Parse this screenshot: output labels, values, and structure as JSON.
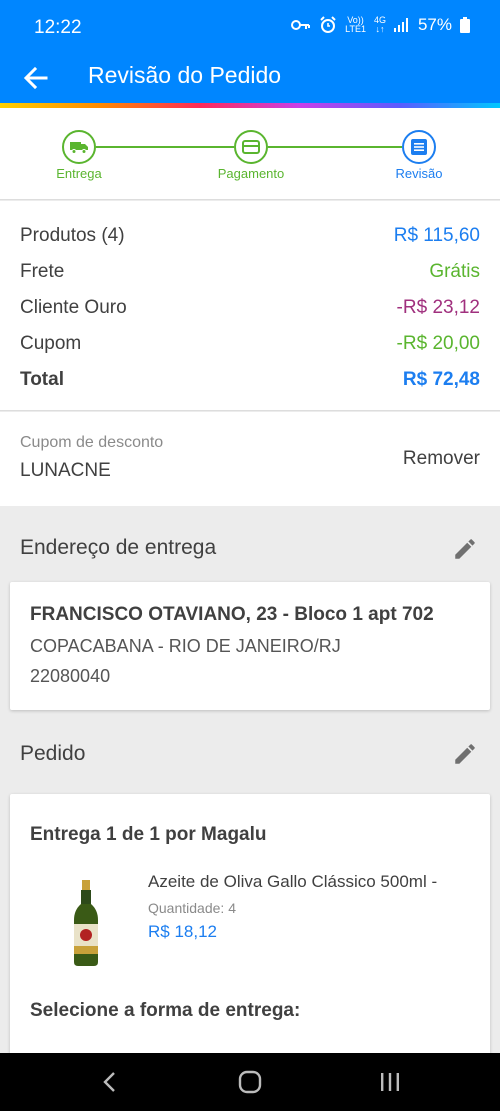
{
  "status_bar": {
    "time": "12:22",
    "vo_top": "Vo))",
    "vo_bottom": "LTE1",
    "net_top": "4G",
    "net_bottom": "↓↑",
    "battery": "57%"
  },
  "header": {
    "title": "Revisão do Pedido"
  },
  "stepper": {
    "steps": [
      {
        "label": "Entrega",
        "state": "done",
        "icon": "truck-icon"
      },
      {
        "label": "Pagamento",
        "state": "done",
        "icon": "card-icon"
      },
      {
        "label": "Revisão",
        "state": "current",
        "icon": "list-icon"
      }
    ]
  },
  "summary": {
    "rows": [
      {
        "label": "Produtos (4)",
        "value": "R$ 115,60",
        "color": "#1c7ef0"
      },
      {
        "label": "Frete",
        "value": "Grátis",
        "color": "#5ab52f"
      },
      {
        "label": "Cliente Ouro",
        "value": "-R$ 23,12",
        "color": "#a0307e"
      },
      {
        "label": "Cupom",
        "value": "-R$ 20,00",
        "color": "#5ab52f"
      },
      {
        "label": "Total",
        "value": "R$ 72,48",
        "color": "#1c7ef0"
      }
    ]
  },
  "coupon": {
    "label": "Cupom de desconto",
    "code": "LUNACNE",
    "remove_label": "Remover"
  },
  "address": {
    "section_title": "Endereço de entrega",
    "line1": "FRANCISCO OTAVIANO, 23 - Bloco 1 apt 702",
    "line2": "COPACABANA - RIO DE JANEIRO/RJ",
    "line3": "22080040"
  },
  "order": {
    "section_title": "Pedido",
    "delivery_title": "Entrega 1 de 1 por Magalu",
    "product": {
      "name": "Azeite de Oliva Gallo Clássico 500ml -",
      "qty_label": "Quantidade:",
      "qty": "4",
      "price": "R$ 18,12"
    },
    "select_delivery": "Selecione a forma de entrega:"
  },
  "colors": {
    "brand_blue": "#0086ff",
    "step_green": "#5ab52f",
    "step_blue": "#1c7ef0"
  }
}
